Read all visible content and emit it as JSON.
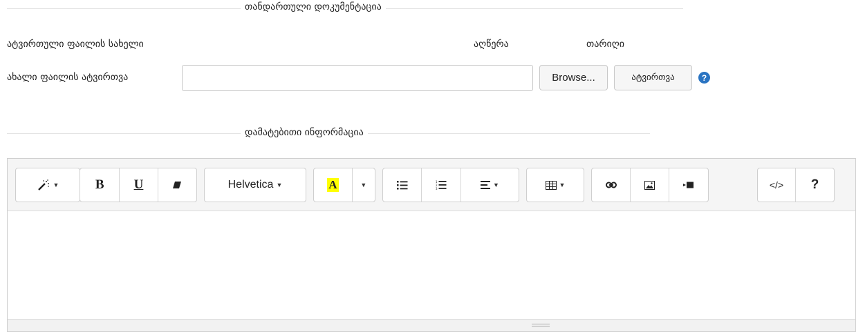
{
  "standard_docs": {
    "title": "თანდართული დოკუმენტაცია",
    "col_filename": "ატვირთული ფაილის სახელი",
    "col_description": "აღწერა",
    "col_date": "თარიღი",
    "upload_label": "ახალი ფაილის ატვირთვა",
    "file_input_value": "",
    "browse_label": "Browse...",
    "upload_button": "ატვირთვა",
    "help_glyph": "?",
    "help_icon": "question-circle-icon"
  },
  "additional_info": {
    "title": "დამატებითი ინფორმაცია"
  },
  "editor": {
    "font_name": "Helvetica",
    "bold": "B",
    "underline": "U",
    "help": "?",
    "code_view": "</>",
    "body_text": "",
    "icons": [
      "magic-wand-icon",
      "bold-icon",
      "underline-icon",
      "eraser-icon",
      "font-color-icon",
      "unordered-list-icon",
      "ordered-list-icon",
      "align-icon",
      "table-icon",
      "link-icon",
      "picture-icon",
      "video-icon",
      "code-view-icon",
      "help-icon"
    ]
  },
  "colors": {
    "highlight": "#ffff00",
    "help_icon_bg": "#2a74c2",
    "toolbar_bg": "#f5f5f5"
  }
}
